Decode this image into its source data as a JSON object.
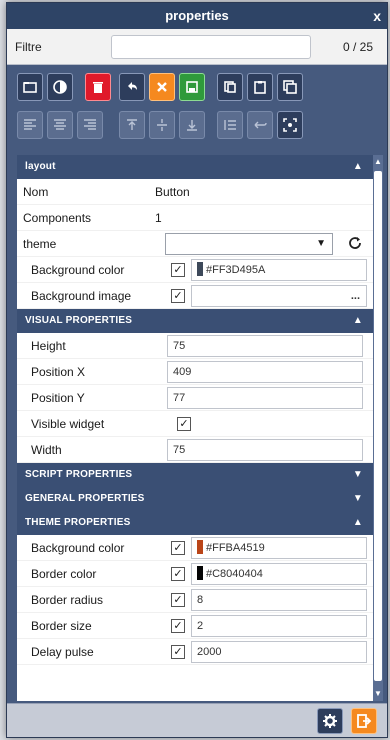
{
  "window": {
    "title": "properties",
    "close_symbol": "x"
  },
  "filter": {
    "label": "Filtre",
    "value": "",
    "count": "0 / 25"
  },
  "toolbar_row1": [
    "open-folder-icon",
    "contrast-icon",
    "delete-icon",
    "undo-icon",
    "cancel-icon",
    "save-icon",
    "copy-icon",
    "paste-icon",
    "duplicate-icon"
  ],
  "toolbar_row2": [
    "align-left-icon",
    "align-center-icon",
    "align-right-icon",
    "align-top-icon",
    "align-middle-icon",
    "align-bottom-icon",
    "list-icon",
    "wrap-icon",
    "fit-icon"
  ],
  "sections": {
    "layout": {
      "title": "layout",
      "expanded": true
    },
    "visual": {
      "title": "VISUAL PROPERTIES",
      "expanded": true
    },
    "script": {
      "title": "SCRIPT PROPERTIES",
      "expanded": false
    },
    "general": {
      "title": "GENERAL PROPERTIES",
      "expanded": false
    },
    "theme": {
      "title": "THEME PROPERTIES",
      "expanded": true
    }
  },
  "layout": {
    "nom_label": "Nom",
    "nom_value": "Button",
    "components_label": "Components",
    "components_value": "1",
    "theme_label": "theme",
    "theme_value": "",
    "bgcolor_label": "Background color",
    "bgcolor_value": "#FF3D495A",
    "bgcolor_swatch": "#3D495A",
    "bgcolor_checked": true,
    "bgimage_label": "Background image",
    "bgimage_value": "",
    "bgimage_checked": true,
    "bgimage_more": "..."
  },
  "visual": {
    "height_label": "Height",
    "height_value": "75",
    "posx_label": "Position X",
    "posx_value": "409",
    "posy_label": "Position Y",
    "posy_value": "77",
    "visible_label": "Visible widget",
    "visible_checked": true,
    "width_label": "Width",
    "width_value": "75"
  },
  "theme": {
    "bgcolor_label": "Background color",
    "bgcolor_value": "#FFBA4519",
    "bgcolor_swatch": "#BA4519",
    "border_color_label": "Border color",
    "border_color_value": "#C8040404",
    "border_color_swatch": "#040404",
    "border_radius_label": "Border radius",
    "border_radius_value": "8",
    "border_size_label": "Border size",
    "border_size_value": "2",
    "delay_pulse_label": "Delay pulse",
    "delay_pulse_value": "2000"
  },
  "colors": {
    "accent_red": "#e0192a",
    "accent_orange": "#f5891f",
    "accent_green": "#2f9a3b",
    "header": "#2e4466"
  }
}
